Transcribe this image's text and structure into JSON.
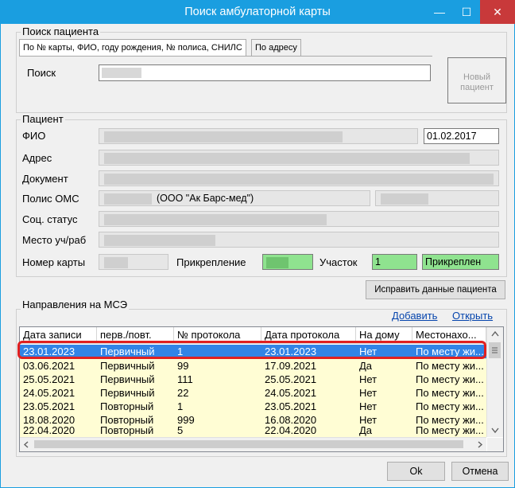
{
  "window": {
    "title": "Поиск амбулаторной карты",
    "minimize_glyph": "—",
    "maximize_glyph": "☐",
    "close_glyph": "✕"
  },
  "search": {
    "group_label": "Поиск пациента",
    "tabs": [
      "По № карты, ФИО, году рождения, № полиса, СНИЛС",
      "По адресу"
    ],
    "search_label": "Поиск",
    "search_value": "",
    "new_patient_button": "Новый пациент"
  },
  "patient": {
    "group_label": "Пациент",
    "fio_label": "ФИО",
    "birth_date": "01.02.2017",
    "address_label": "Адрес",
    "document_label": "Документ",
    "oms_label": "Полис ОМС",
    "oms_insurer": "(ООО \"Ак Барс-мед\")",
    "social_label": "Соц. статус",
    "work_label": "Место уч/раб",
    "card_label": "Номер карты",
    "attach_label": "Прикрепление",
    "district_label": "Участок",
    "district_value": "1",
    "attach_status": "Прикреплен",
    "fix_button": "Исправить данные пациента"
  },
  "mse": {
    "group_label": "Направления на МСЭ",
    "add_link": "Добавить",
    "open_link": "Открыть",
    "columns": [
      "Дата записи",
      "перв./повт.",
      "№ протокола",
      "Дата протокола",
      "На дому",
      "Местонахо..."
    ],
    "rows": [
      [
        "23.01.2023",
        "Первичный",
        "1",
        "23.01.2023",
        "Нет",
        "По месту жи..."
      ],
      [
        "03.06.2021",
        "Первичный",
        "99",
        "17.09.2021",
        "Да",
        "По месту жи..."
      ],
      [
        "25.05.2021",
        "Первичный",
        "111",
        "25.05.2021",
        "Нет",
        "По месту жи..."
      ],
      [
        "24.05.2021",
        "Первичный",
        "22",
        "24.05.2021",
        "Нет",
        "По месту жи..."
      ],
      [
        "23.05.2021",
        "Повторный",
        "1",
        "23.05.2021",
        "Нет",
        "По месту жи..."
      ],
      [
        "18.08.2020",
        "Повторный",
        "999",
        "16.08.2020",
        "Нет",
        "По месту жи..."
      ],
      [
        "22.04.2020",
        "Повторный",
        "5",
        "22.04.2020",
        "Да",
        "По месту жи..."
      ]
    ]
  },
  "footer": {
    "ok_button": "Ok",
    "cancel_button": "Отмена"
  },
  "icons": {
    "scroll_up": "chevron-up-icon",
    "scroll_down": "chevron-down-icon",
    "scroll_left": "chevron-left-icon",
    "scroll_right": "chevron-right-icon"
  },
  "colors": {
    "titlebar": "#1a9ee0",
    "close": "#c8393a",
    "selected_row": "#3284e6",
    "row_bg": "#fffdd4",
    "highlight_ring": "#e02020",
    "attach_green": "#8fe38f"
  }
}
